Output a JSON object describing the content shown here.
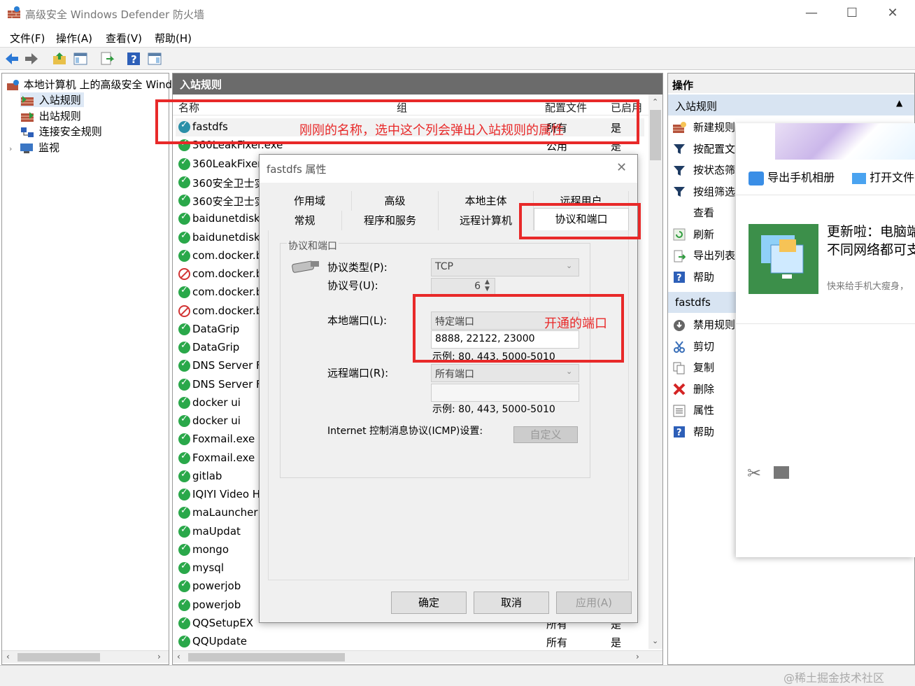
{
  "window": {
    "title": "高级安全 Windows Defender 防火墙",
    "minimize": "—",
    "maximize": "☐",
    "close": "✕"
  },
  "menu": [
    "文件(F)",
    "操作(A)",
    "查看(V)",
    "帮助(H)"
  ],
  "tree": {
    "root": "本地计算机 上的高级安全 Wind",
    "inbound": "入站规则",
    "outbound": "出站规则",
    "connection": "连接安全规则",
    "monitor": "监视"
  },
  "center": {
    "header": "入站规则",
    "columns": {
      "name": "名称",
      "group": "组",
      "profile": "配置文件",
      "enabled": "已启用"
    },
    "rows": [
      {
        "name": "fastdfs",
        "profile": "所有",
        "enabled": "是",
        "icon": "tick"
      },
      {
        "name": "360LeakFixer.exe",
        "profile": "公用",
        "enabled": "是",
        "icon": "tick"
      },
      {
        "name": "360LeakFixer.",
        "profile": "",
        "enabled": "",
        "icon": "tick"
      },
      {
        "name": "360安全卫士实",
        "profile": "",
        "enabled": "",
        "icon": "tick"
      },
      {
        "name": "360安全卫士实",
        "profile": "",
        "enabled": "",
        "icon": "tick"
      },
      {
        "name": "baidunetdiskh",
        "profile": "",
        "enabled": "",
        "icon": "tick"
      },
      {
        "name": "baidunetdiskh",
        "profile": "",
        "enabled": "",
        "icon": "tick"
      },
      {
        "name": "com.docker.ba",
        "profile": "",
        "enabled": "",
        "icon": "tick"
      },
      {
        "name": "com.docker.ba",
        "profile": "",
        "enabled": "",
        "icon": "block"
      },
      {
        "name": "com.docker.ba",
        "profile": "",
        "enabled": "",
        "icon": "tick"
      },
      {
        "name": "com.docker.ba",
        "profile": "",
        "enabled": "",
        "icon": "block"
      },
      {
        "name": "DataGrip",
        "profile": "",
        "enabled": "",
        "icon": "tick"
      },
      {
        "name": "DataGrip",
        "profile": "",
        "enabled": "",
        "icon": "tick"
      },
      {
        "name": "DNS Server Fo",
        "profile": "",
        "enabled": "",
        "icon": "tick"
      },
      {
        "name": "DNS Server Fo",
        "profile": "",
        "enabled": "",
        "icon": "tick"
      },
      {
        "name": "docker ui",
        "profile": "",
        "enabled": "",
        "icon": "tick"
      },
      {
        "name": "docker ui",
        "profile": "",
        "enabled": "",
        "icon": "tick"
      },
      {
        "name": "Foxmail.exe",
        "profile": "",
        "enabled": "",
        "icon": "tick"
      },
      {
        "name": "Foxmail.exe",
        "profile": "",
        "enabled": "",
        "icon": "tick"
      },
      {
        "name": "gitlab",
        "profile": "",
        "enabled": "",
        "icon": "tick"
      },
      {
        "name": "IQIYI Video He",
        "profile": "",
        "enabled": "",
        "icon": "tick"
      },
      {
        "name": "maLauncher",
        "profile": "",
        "enabled": "",
        "icon": "tick"
      },
      {
        "name": "maUpdat",
        "profile": "",
        "enabled": "",
        "icon": "tick"
      },
      {
        "name": "mongo",
        "profile": "",
        "enabled": "",
        "icon": "tick"
      },
      {
        "name": "mysql",
        "profile": "",
        "enabled": "",
        "icon": "tick"
      },
      {
        "name": "powerjob",
        "profile": "",
        "enabled": "",
        "icon": "tick"
      },
      {
        "name": "powerjob",
        "profile": "",
        "enabled": "",
        "icon": "tick"
      },
      {
        "name": "QQSetupEX",
        "profile": "所有",
        "enabled": "是",
        "icon": "tick"
      },
      {
        "name": "QQUpdate",
        "profile": "所有",
        "enabled": "是",
        "icon": "tick"
      }
    ]
  },
  "actions": {
    "header": "操作",
    "section1": "入站规则",
    "items1": [
      "新建规则",
      "按配置文",
      "按状态筛",
      "按组筛选",
      "查看",
      "刷新",
      "导出列表",
      "帮助"
    ],
    "section2": "fastdfs",
    "items2": [
      "禁用规则",
      "剪切",
      "复制",
      "删除",
      "属性",
      "帮助"
    ]
  },
  "dialog": {
    "title": "fastdfs 属性",
    "tabs_row1": [
      "作用域",
      "高级",
      "本地主体",
      "远程用户"
    ],
    "tabs_row2": [
      "常规",
      "程序和服务",
      "远程计算机",
      "协议和端口"
    ],
    "group": "协议和端口",
    "protocol_type_label": "协议类型(P):",
    "protocol_type": "TCP",
    "protocol_number_label": "协议号(U):",
    "protocol_number": "6",
    "local_port_label": "本地端口(L):",
    "local_port_mode": "特定端口",
    "local_port_value": "8888, 22122, 23000",
    "local_example": "示例: 80, 443, 5000-5010",
    "remote_port_label": "远程端口(R):",
    "remote_port_mode": "所有端口",
    "remote_example": "示例: 80, 443, 5000-5010",
    "icmp_label": "Internet 控制消息协议(ICMP)设置:",
    "customize": "自定义",
    "ok": "确定",
    "cancel": "取消",
    "apply": "应用(A)"
  },
  "annotations": {
    "name_note": "刚刚的名称，选中这个列会弹出入站规则的属性",
    "port_note": "开通的端口"
  },
  "popup": {
    "export": "导出手机相册",
    "open": "打开文件",
    "title": "更新啦：电脑端",
    "subtitle": "不同网络都可支",
    "note": "快来给手机大瘦身，"
  },
  "watermark": "@稀土掘金技术社区",
  "colors": {
    "annotation": "#e82929",
    "header": "#6b6b6b",
    "accent": "#d8e4f2"
  }
}
